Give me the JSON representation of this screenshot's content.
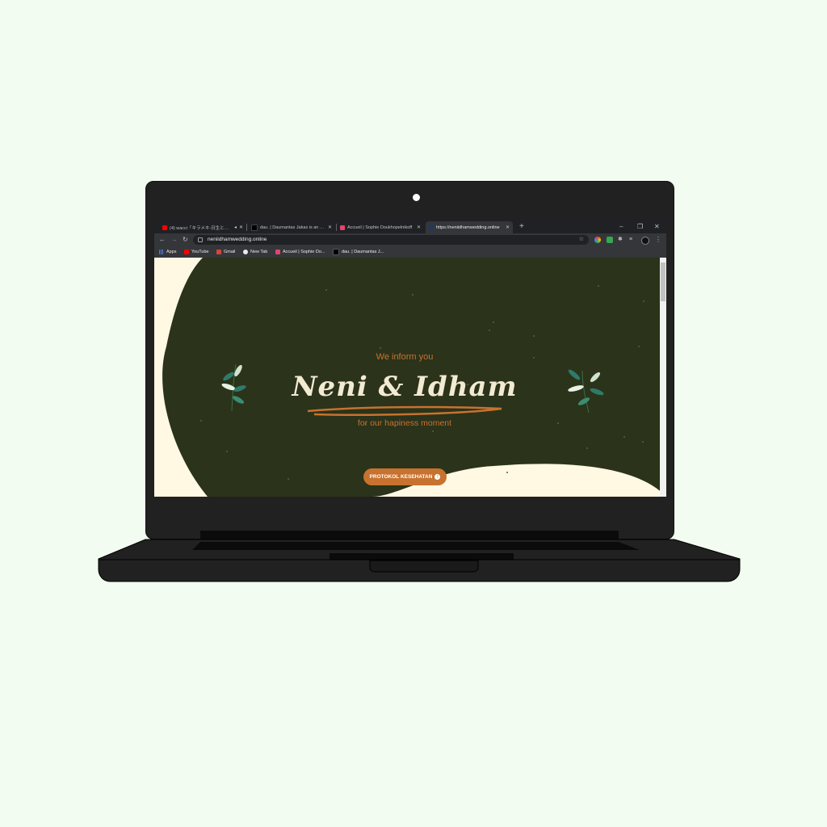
{
  "browser": {
    "tabs": [
      {
        "title": "(4) wacci「キラメキ-日生とか-」",
        "favicon_color": "#ff0000",
        "muted_icon": "speaker-icon"
      },
      {
        "title": "dau. | Daumantas Jakas is an awa",
        "favicon_color": "#000000"
      },
      {
        "title": "Accueil | Sophie Doukhopelnikoff",
        "favicon_color": "#e0456b"
      },
      {
        "title": "https://neniidhamwedding.online",
        "favicon_color": "#1b3a6b",
        "active": true
      }
    ],
    "url": "neniidhamwedding.online",
    "bookmarks": [
      {
        "label": "Apps",
        "icon": "apps-grid-icon",
        "color": "#4285f4"
      },
      {
        "label": "YouTube",
        "icon": "youtube-icon",
        "color": "#ff0000"
      },
      {
        "label": "Gmail",
        "icon": "gmail-icon",
        "color": "#d44638"
      },
      {
        "label": "New Tab",
        "icon": "globe-icon",
        "color": "#e8eaed"
      },
      {
        "label": "Accueil | Sophie Do...",
        "icon": "sophie-icon",
        "color": "#e0456b"
      },
      {
        "label": "dau. | Daumantas J...",
        "icon": "dau-icon",
        "color": "#000000"
      }
    ]
  },
  "hero": {
    "intro": "We inform you",
    "names": "Neni & Idham",
    "subtitle": "for our hapiness moment",
    "button_label": "PROTOKOL KESEHATAN",
    "colors": {
      "background": "#2b331a",
      "accent": "#c8722f",
      "cream": "#fff8e3",
      "script": "#f3ead2"
    }
  }
}
